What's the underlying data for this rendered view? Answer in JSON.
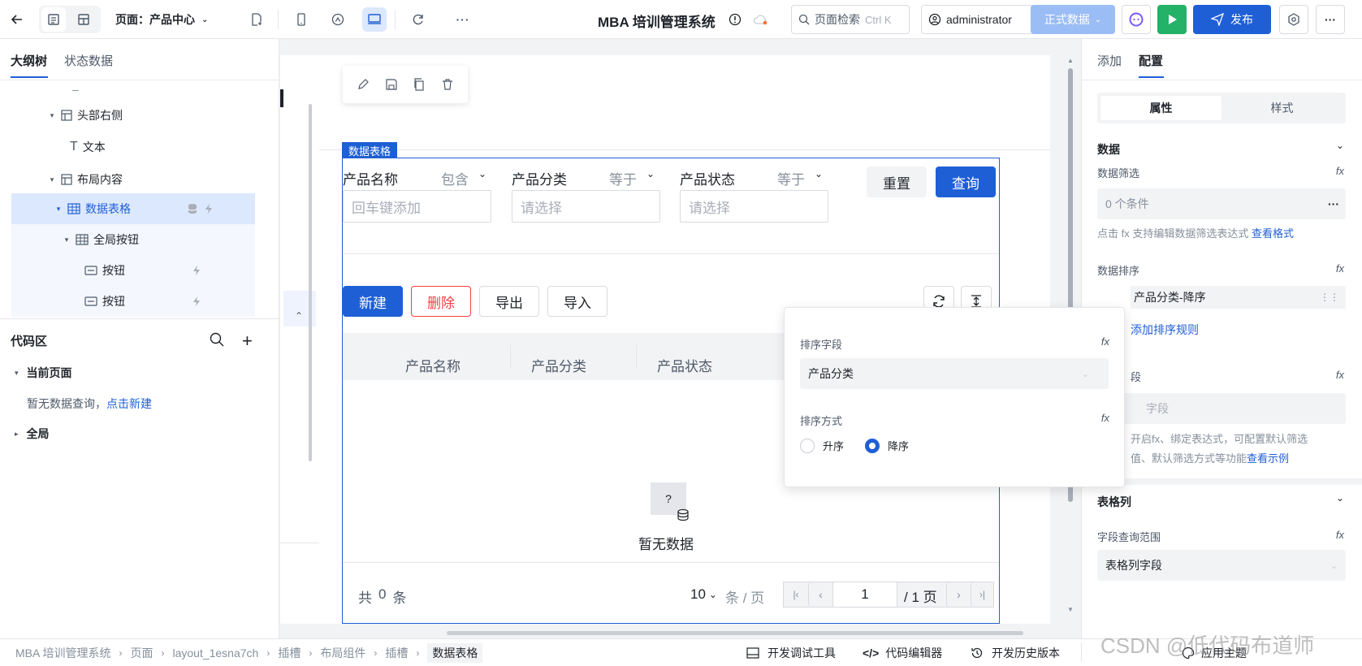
{
  "topbar": {
    "page_label": "页面：产品中心",
    "app_title": "MBA 培训管理系统",
    "search_placeholder": "页面检索",
    "search_shortcut": "Ctrl K",
    "user": "administrator",
    "env": "正式数据",
    "publish": "发布"
  },
  "left": {
    "tabs": [
      "大纲树",
      "状态数据"
    ],
    "tree": [
      {
        "label": "–"
      },
      {
        "label": "头部右侧"
      },
      {
        "label": "文本"
      },
      {
        "label": "布局内容"
      },
      {
        "label": "数据表格"
      },
      {
        "label": "全局按钮"
      },
      {
        "label": "按钮"
      },
      {
        "label": "按钮"
      }
    ],
    "code_title": "代码区",
    "current_page": "当前页面",
    "no_query": "暂无数据查询，",
    "new_link": "点击新建",
    "global": "全局"
  },
  "canvas": {
    "table_tag": "数据表格",
    "filters": [
      {
        "label": "产品名称",
        "op": "包含",
        "placeholder": "回车键添加"
      },
      {
        "label": "产品分类",
        "op": "等于",
        "placeholder": "请选择"
      },
      {
        "label": "产品状态",
        "op": "等于",
        "placeholder": "请选择"
      }
    ],
    "reset": "重置",
    "query": "查询",
    "actions": [
      "新建",
      "删除",
      "导出",
      "导入"
    ],
    "columns": [
      "产品名称",
      "产品分类",
      "产品状态"
    ],
    "empty": "暂无数据",
    "total_prefix": "共",
    "total": "0",
    "total_suffix": "条",
    "page_size": "10",
    "per_page": "条 / 页",
    "page": "1",
    "page_total": "/ 1 页"
  },
  "popover": {
    "field_label": "排序字段",
    "field_value": "产品分类",
    "order_label": "排序方式",
    "asc": "升序",
    "desc": "降序",
    "selected": "desc"
  },
  "right": {
    "tabs": [
      "添加",
      "配置"
    ],
    "seg": [
      "属性",
      "样式"
    ],
    "data_title": "数据",
    "filter_label": "数据筛选",
    "filter_value": "0 个条件",
    "filter_hint": "点击 fx 支持编辑数据筛选表达式",
    "filter_link": "查看格式",
    "sort_label": "数据排序",
    "sort_rule": "产品分类-降序",
    "add_sort": "添加排序规则",
    "hidden_label_tail": "段",
    "hidden_field": "字段",
    "hint_line1": "开启fx、绑定表达式，可配置默认筛选",
    "hint_line2": "值、默认筛选方式等功能",
    "hint_link": "查看示例",
    "columns_title": "表格列",
    "range_label": "字段查询范围",
    "range_value": "表格列字段"
  },
  "bottom": {
    "crumbs": [
      "MBA 培训管理系统",
      "页面",
      "layout_1esna7ch",
      "插槽",
      "布局组件",
      "插槽",
      "数据表格"
    ],
    "tools": [
      "开发调试工具",
      "代码编辑器",
      "开发历史版本",
      "应用主题"
    ],
    "watermark": "CSDN @低代码布道师"
  }
}
